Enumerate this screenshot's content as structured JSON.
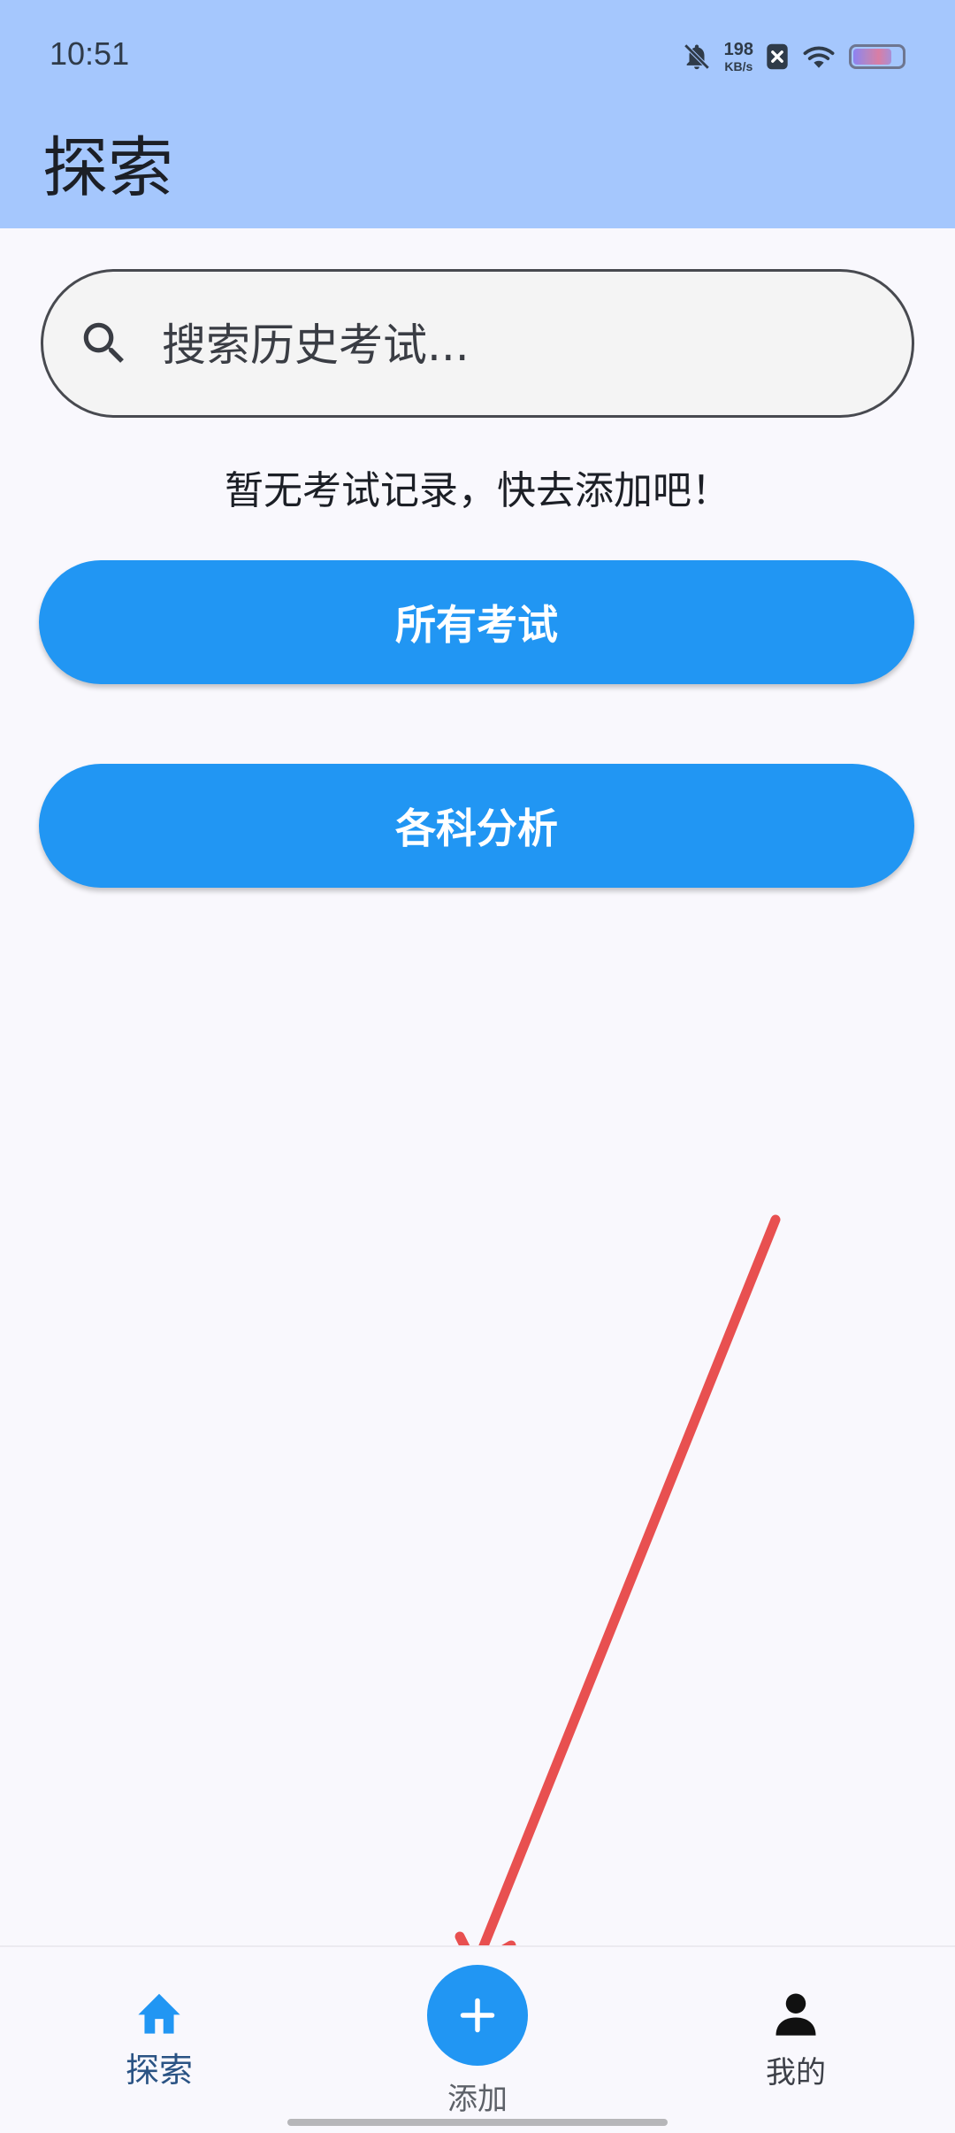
{
  "status_bar": {
    "time": "10:51",
    "net_speed_value": "198",
    "net_speed_unit": "KB/s",
    "battery_level": 0.8,
    "icons": [
      "bell-off-icon",
      "sim-x-icon",
      "wifi-icon",
      "battery-icon"
    ]
  },
  "app_bar": {
    "title": "探索"
  },
  "search": {
    "placeholder": "搜索历史考试...",
    "value": ""
  },
  "empty_message": "暂无考试记录，快去添加吧！",
  "buttons": {
    "all_exams": "所有考试",
    "subject_analysis": "各科分析"
  },
  "bottom_nav": {
    "items": [
      {
        "label": "探索",
        "icon": "home-icon",
        "active": true
      },
      {
        "label": "添加",
        "icon": "plus-icon",
        "active": false
      },
      {
        "label": "我的",
        "icon": "person-icon",
        "active": false
      }
    ]
  },
  "colors": {
    "primary": "#2196f3",
    "app_bar": "#a5c7fd",
    "background": "#f9f8fd",
    "annotation_arrow": "#e85050"
  }
}
